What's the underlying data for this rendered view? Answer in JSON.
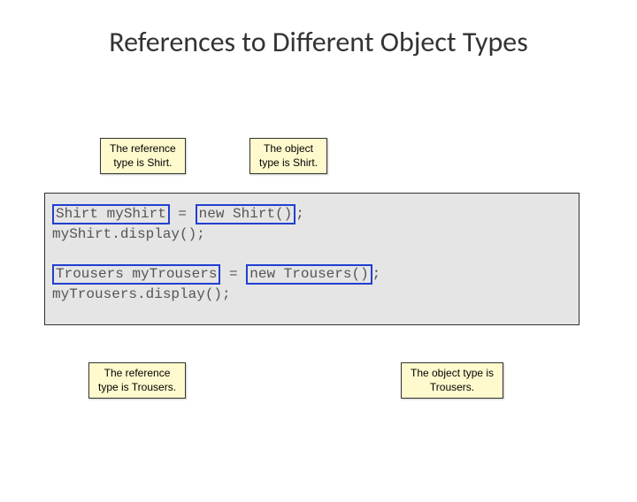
{
  "title": "References to Different Object Types",
  "notes": {
    "ref_shirt": "The reference\ntype is Shirt.",
    "obj_shirt": "The object\ntype is Shirt.",
    "ref_trousers": "The reference\ntype is Trousers.",
    "obj_trousers": "The object type is\nTrousers."
  },
  "code": {
    "l1a": "Shirt myShirt",
    "l1eq": " = ",
    "l1b": "new Shirt()",
    "l1c": ";",
    "l2": "myShirt.display();",
    "l3": "",
    "l4a": "Trousers myTrousers",
    "l4eq": " = ",
    "l4b": "new Trousers()",
    "l4c": ";",
    "l5": "myTrousers.display();"
  }
}
